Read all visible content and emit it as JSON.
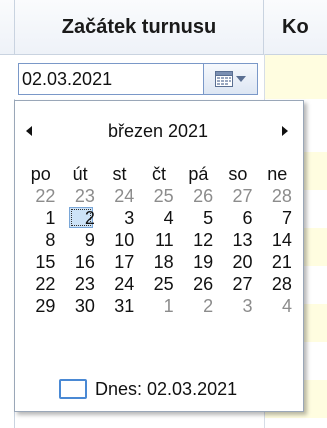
{
  "grid": {
    "columns": [
      {
        "header": "Začátek turnusu"
      },
      {
        "header": "Ko"
      }
    ]
  },
  "date_editor": {
    "value": "02.03.2021"
  },
  "calendar": {
    "month_title": "březen 2021",
    "weekdays": [
      "po",
      "út",
      "st",
      "čt",
      "pá",
      "so",
      "ne"
    ],
    "weeks": [
      [
        {
          "d": "22",
          "other": true
        },
        {
          "d": "23",
          "other": true
        },
        {
          "d": "24",
          "other": true
        },
        {
          "d": "25",
          "other": true
        },
        {
          "d": "26",
          "other": true
        },
        {
          "d": "27",
          "other": true
        },
        {
          "d": "28",
          "other": true
        }
      ],
      [
        {
          "d": "1"
        },
        {
          "d": "2",
          "selected": true
        },
        {
          "d": "3"
        },
        {
          "d": "4"
        },
        {
          "d": "5"
        },
        {
          "d": "6"
        },
        {
          "d": "7"
        }
      ],
      [
        {
          "d": "8"
        },
        {
          "d": "9"
        },
        {
          "d": "10"
        },
        {
          "d": "11"
        },
        {
          "d": "12"
        },
        {
          "d": "13"
        },
        {
          "d": "14"
        }
      ],
      [
        {
          "d": "15"
        },
        {
          "d": "16"
        },
        {
          "d": "17"
        },
        {
          "d": "18"
        },
        {
          "d": "19"
        },
        {
          "d": "20"
        },
        {
          "d": "21"
        }
      ],
      [
        {
          "d": "22"
        },
        {
          "d": "23"
        },
        {
          "d": "24"
        },
        {
          "d": "25"
        },
        {
          "d": "26"
        },
        {
          "d": "27"
        },
        {
          "d": "28"
        }
      ],
      [
        {
          "d": "29"
        },
        {
          "d": "30"
        },
        {
          "d": "31"
        },
        {
          "d": "1",
          "other": true
        },
        {
          "d": "2",
          "other": true
        },
        {
          "d": "3",
          "other": true
        },
        {
          "d": "4",
          "other": true
        }
      ]
    ],
    "today_label": "Dnes: 02.03.2021"
  },
  "icons": {
    "prev": "chevron-left-icon",
    "next": "chevron-right-icon",
    "dropdown": "calendar-icon"
  },
  "colors": {
    "accent": "#4a89d4",
    "selected_fill": "#cde3f7",
    "editor_row": "#fffde0",
    "other_month_text": "#8c8c8c"
  }
}
